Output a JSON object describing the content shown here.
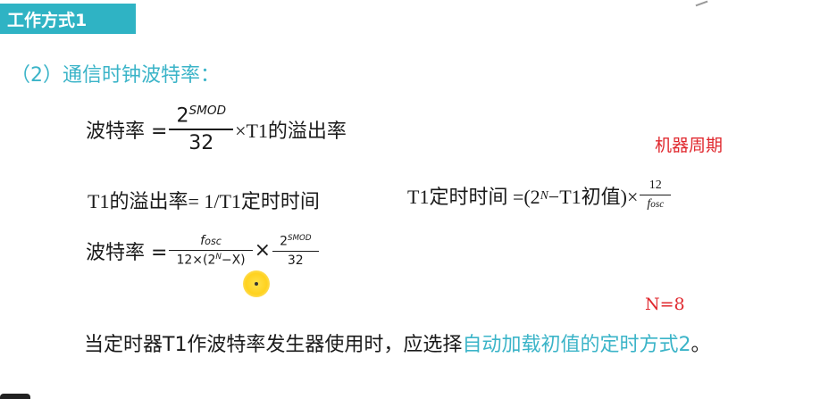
{
  "header": {
    "title": "工作方式1"
  },
  "section": {
    "heading": "（2）通信时钟波特率："
  },
  "formula1": {
    "lhs": "波特率 =",
    "num_base": "2",
    "num_exp": "SMOD",
    "den": "32",
    "rhs": "×T1的溢出率"
  },
  "formula2": {
    "text": "T1的溢出率= 1/T1定时时间"
  },
  "formula3": {
    "lhs": "T1定时时间 =(2",
    "exp": "N",
    "mid": " −T1初值)×",
    "num": "12",
    "den_f": "f",
    "den_sub": "osc"
  },
  "formula4": {
    "lhs": "波特率 =",
    "num_f": "f",
    "num_sub": "osc",
    "den_a": "12×(2",
    "den_exp": "N",
    "den_b": "−X)",
    "times": "×",
    "num2_base": "2",
    "num2_exp": "SMOD",
    "den2": "32"
  },
  "notes": {
    "machine_cycle": "机器周期",
    "n_value": "N=8"
  },
  "conclusion": {
    "prefix": "当定时器T1作波特率发生器使用时，应选择",
    "highlight": "自动加载初值的定时方式2",
    "suffix": "。"
  }
}
